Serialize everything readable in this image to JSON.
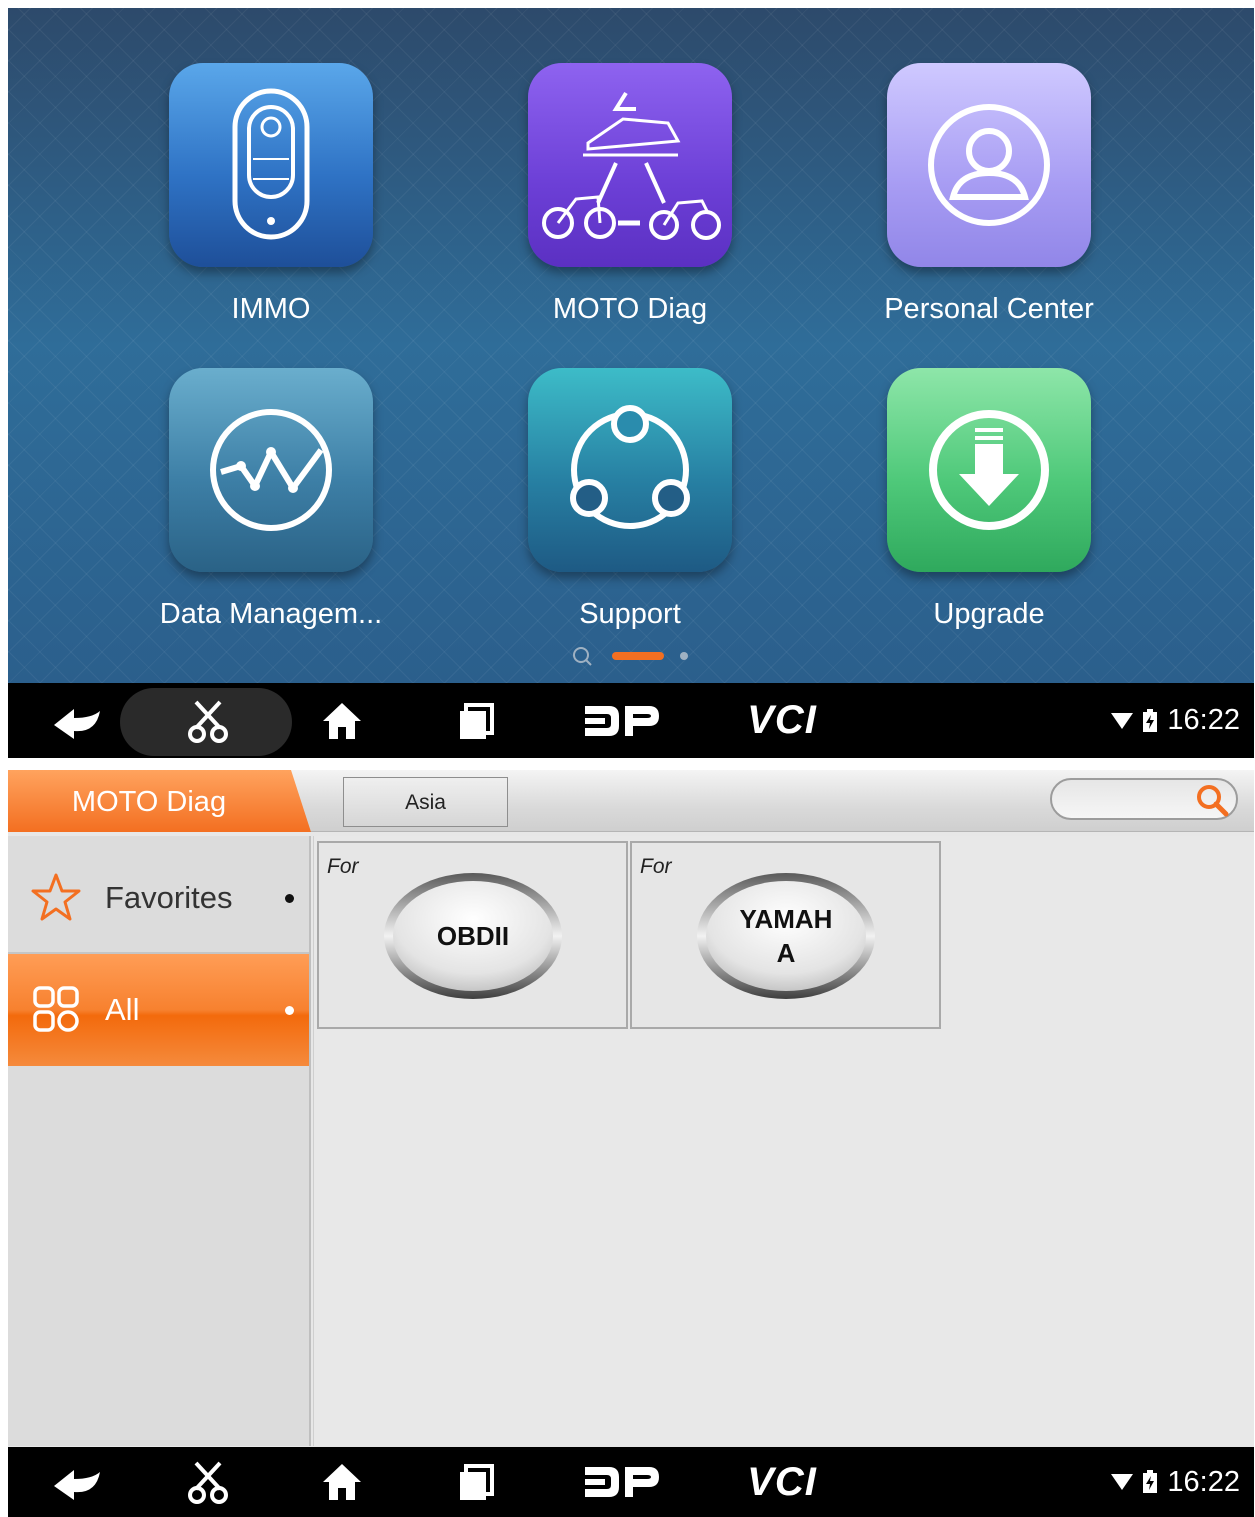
{
  "home": {
    "apps": [
      {
        "label": "IMMO",
        "icon": "key-fob-icon"
      },
      {
        "label": "MOTO Diag",
        "icon": "vehicles-triangle-icon"
      },
      {
        "label": "Personal Center",
        "icon": "user-circle-icon"
      },
      {
        "label": "Data Managem...",
        "icon": "chart-circle-icon"
      },
      {
        "label": "Support",
        "icon": "share-nodes-icon"
      },
      {
        "label": "Upgrade",
        "icon": "download-circle-icon"
      }
    ],
    "pager": {
      "pages": 2,
      "current": 1,
      "accent": "#f36f21"
    }
  },
  "navbar": {
    "buttons": [
      "back-icon",
      "screenshot-scissors-icon",
      "home-icon",
      "recent-apps-icon",
      "dp-logo-icon",
      "vci-icon"
    ],
    "vci_label": "VCI",
    "time": "16:22"
  },
  "diag": {
    "breadcrumb": "MOTO Diag",
    "tab": "Asia",
    "search": {
      "placeholder": ""
    },
    "sidebar": [
      {
        "label": "Favorites",
        "icon": "star-icon",
        "selected": false
      },
      {
        "label": "All",
        "icon": "grid-icon",
        "selected": true
      }
    ],
    "items": [
      {
        "prefix": "For",
        "label": "OBDII"
      },
      {
        "prefix": "For",
        "label": "YAMAH A"
      }
    ],
    "accent": "#f36f21"
  }
}
